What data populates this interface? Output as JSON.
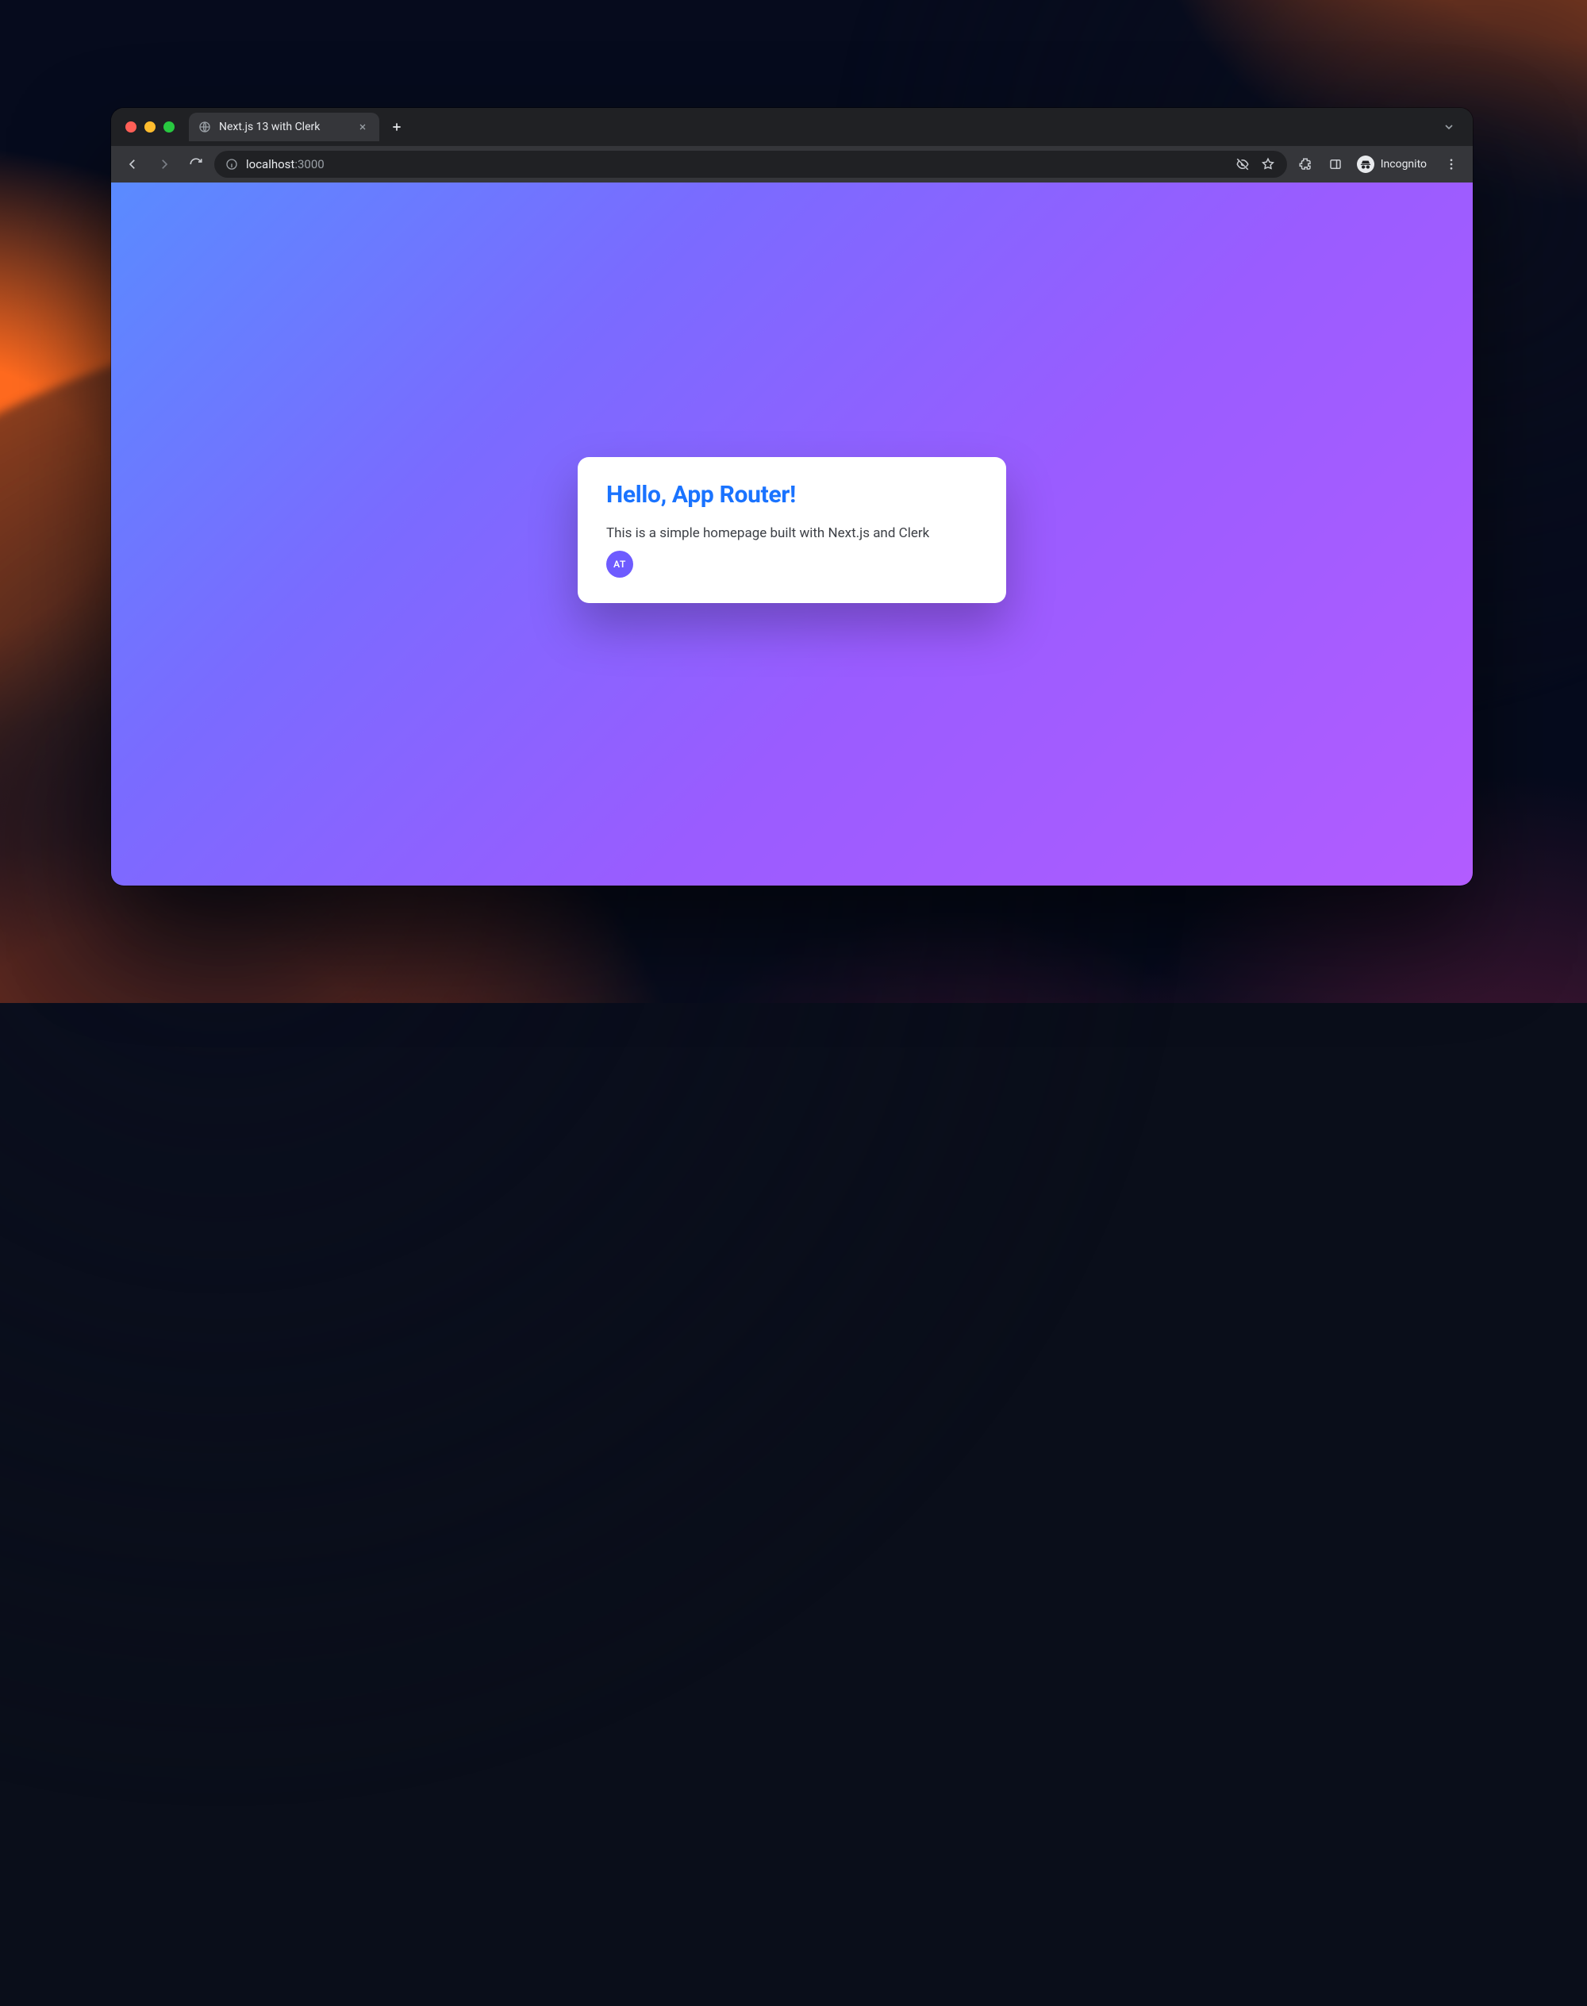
{
  "browser": {
    "tab_title": "Next.js 13 with Clerk",
    "url_host": "localhost",
    "url_port": ":3000",
    "incognito_label": "Incognito"
  },
  "page": {
    "heading": "Hello, App Router!",
    "body": "This is a simple homepage built with Next.js and Clerk",
    "avatar_initials": "AT"
  }
}
